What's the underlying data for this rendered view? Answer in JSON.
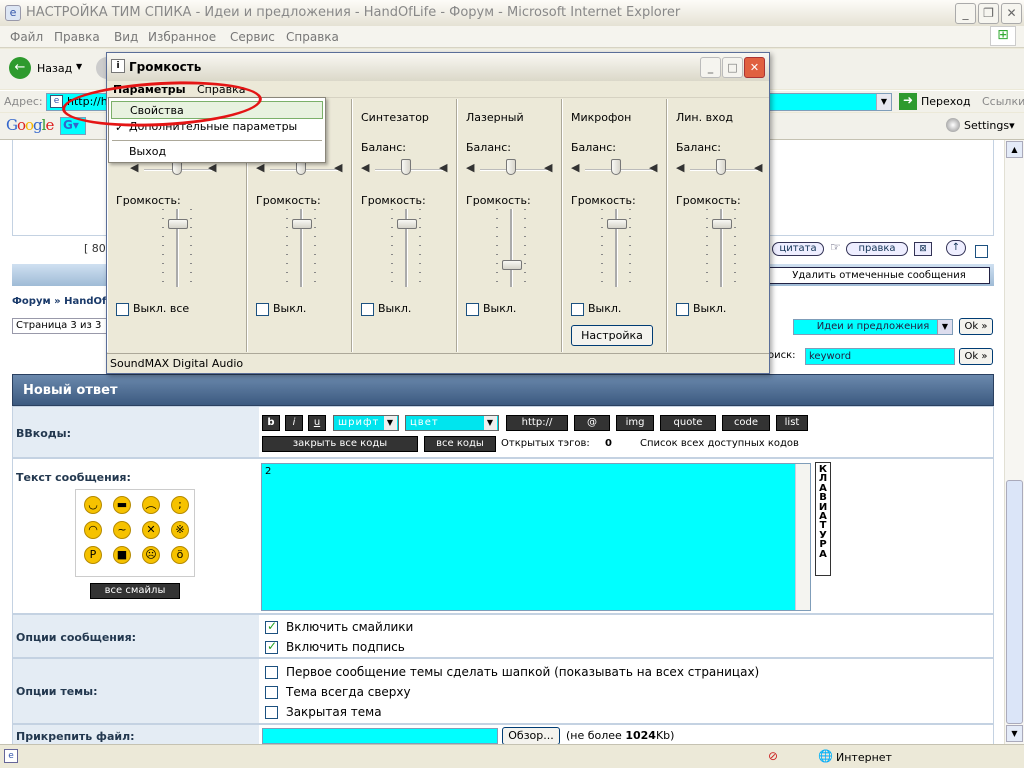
{
  "window": {
    "title": "НАСТРОЙКА ТИМ СПИКА - Идеи и предложения - HandOfLife - Форум - Microsoft Internet Explorer"
  },
  "menu": [
    "Файл",
    "Правка",
    "Вид",
    "Избранное",
    "Сервис",
    "Справка"
  ],
  "toolbar": {
    "back": "Назад"
  },
  "address": {
    "label": "Адрес:",
    "value": "http://h",
    "go": "Переход",
    "links": "Ссылки"
  },
  "google": {
    "settings": "Settings▾"
  },
  "forum": {
    "post_actions": {
      "quote": "цитата",
      "edit": "правка"
    },
    "page_counter": "[ 80",
    "delete_selected": "Удалить отмеченные сообщения",
    "breadcrumb": {
      "forum": "Форум",
      "sep": "»",
      "next": "HandOfLi"
    },
    "pages": "Страница 3 из 3",
    "jump_select": "Идеи и предложения",
    "ok": "Ok »",
    "search_label": "оиск:",
    "search_value": "keyword",
    "reply_header": "Новый ответ",
    "bbcode_label": "ВВкоды:",
    "bb_buttons": [
      "b",
      "i",
      "u"
    ],
    "font_select": "шрифт",
    "color_select": "цвет",
    "bb_tags": [
      "http://",
      "@",
      "img",
      "quote",
      "code",
      "list"
    ],
    "close_all": "закрыть все коды",
    "all_codes": "все коды",
    "open_tags_label": "Открытых тэгов:",
    "open_tags_value": "0",
    "all_codes_list": "Список всех доступных кодов",
    "message_label": "Текст сообщения:",
    "message_value": "2",
    "keyboard": "КЛАВИАТУРА",
    "all_smilies": "все смайлы",
    "msg_options_label": "Опции сообщения:",
    "opt_smilies": "Включить смайлики",
    "opt_signature": "Включить подпись",
    "topic_options_label": "Опции темы:",
    "opt_first": "Первое сообщение темы сделать шапкой (показывать на всех страницах)",
    "opt_top": "Тема всегда сверху",
    "opt_closed": "Закрытая тема",
    "attach_label": "Прикрепить файл:",
    "browse": "Обзор...",
    "limit_pre": "(не более ",
    "limit_bold": "1024",
    "limit_post": "Kb)"
  },
  "status": {
    "zone": "Интернет"
  },
  "volume": {
    "title": "Громкость",
    "menu": {
      "params": "Параметры",
      "help": "Справка"
    },
    "balance": "Баланс:",
    "volume_label": "Громкость:",
    "mute_all": "Выкл. все",
    "mute": "Выкл.",
    "channels": [
      "Синтезатор",
      "Лазерный",
      "Микрофон",
      "Лин. вход"
    ],
    "advanced": "Настройка",
    "device": "SoundMAX Digital Audio",
    "levels": [
      0.85,
      0.85,
      0.85,
      0.25,
      0.85,
      0.85
    ]
  },
  "popup": {
    "properties": "Свойства",
    "advanced": "Дополнительные параметры",
    "exit": "Выход"
  },
  "colors": {
    "cyan": "#00ffff",
    "header_bg": "#3c5a80",
    "red_mark": "#e41515"
  }
}
